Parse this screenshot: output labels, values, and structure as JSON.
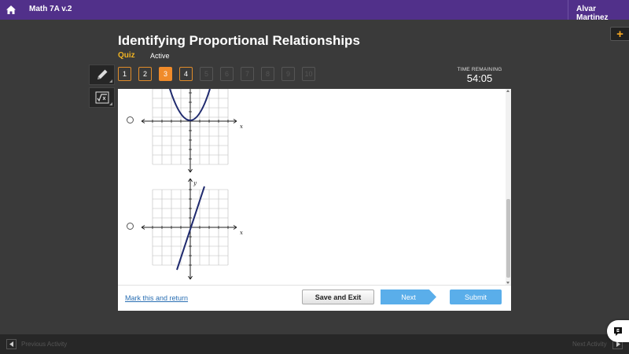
{
  "app": {
    "course_title": "Math 7A v.2",
    "user_name": "Alvar Martinez"
  },
  "lesson": {
    "title": "Identifying Proportional Relationships",
    "type": "Quiz",
    "status": "Active"
  },
  "question_nav": [
    {
      "label": "1",
      "state": "answered"
    },
    {
      "label": "2",
      "state": "answered"
    },
    {
      "label": "3",
      "state": "current"
    },
    {
      "label": "4",
      "state": "answered"
    },
    {
      "label": "5",
      "state": "disabled"
    },
    {
      "label": "6",
      "state": "disabled"
    },
    {
      "label": "7",
      "state": "disabled"
    },
    {
      "label": "8",
      "state": "disabled"
    },
    {
      "label": "9",
      "state": "disabled"
    },
    {
      "label": "10",
      "state": "disabled"
    }
  ],
  "timer": {
    "label": "TIME REMAINING",
    "value": "54:05"
  },
  "tools": [
    {
      "name": "pencil-icon"
    },
    {
      "name": "calculator-icon"
    }
  ],
  "answers": [
    {
      "graph": {
        "x_label": "x",
        "y_label": "",
        "curve": "parabola"
      }
    },
    {
      "graph": {
        "x_label": "x",
        "y_label": "y",
        "curve": "line"
      }
    }
  ],
  "actions": {
    "mark_link": "Mark this and return",
    "save_exit": "Save and Exit",
    "next": "Next",
    "submit": "Submit"
  },
  "footer": {
    "prev_label": "Previous Activity",
    "next_label": "Next Activity"
  },
  "colors": {
    "brand": "#51308a",
    "accent": "#f08b2a",
    "button_blue": "#5aaeea",
    "curve": "#1f2a6e"
  }
}
